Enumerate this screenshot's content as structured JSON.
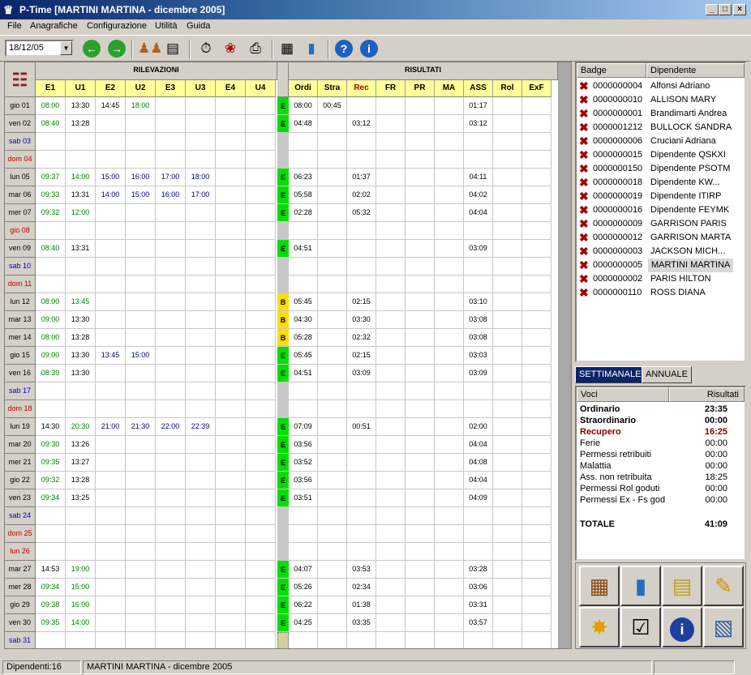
{
  "window": {
    "title": "P-Time [MARTINI MARTINA - dicembre 2005]"
  },
  "menu": [
    "File",
    "Anagrafiche",
    "Configurazione",
    "Utilità",
    "Guida"
  ],
  "toolbar": {
    "date_value": "18/12/05"
  },
  "grid": {
    "group_rilevazioni": "RILEVAZIONI",
    "group_risultati": "RISULTATI",
    "punch_cols": [
      "E1",
      "U1",
      "E2",
      "U2",
      "E3",
      "U3",
      "E4",
      "U4"
    ],
    "result_cols": [
      "Ordi",
      "Stra",
      "Rec",
      "FR",
      "PR",
      "MA",
      "ASS",
      "Rol",
      "ExF"
    ],
    "rows": [
      {
        "day": "gio 01",
        "type": "weekday",
        "p": [
          "08:00",
          "13:30",
          "14:45",
          "18:00",
          "",
          "",
          "",
          ""
        ],
        "s": "E",
        "r": [
          "08:00",
          "00:45",
          "",
          "",
          "",
          "",
          "01:17",
          "",
          ""
        ]
      },
      {
        "day": "ven 02",
        "type": "weekday",
        "p": [
          "08:40",
          "13:28",
          "",
          "",
          "",
          "",
          "",
          ""
        ],
        "s": "E",
        "r": [
          "04:48",
          "",
          "03:12",
          "",
          "",
          "",
          "03:12",
          "",
          ""
        ]
      },
      {
        "day": "sab 03",
        "type": "saturday",
        "p": [
          "",
          "",
          "",
          "",
          "",
          "",
          "",
          ""
        ],
        "s": "",
        "r": [
          "",
          "",
          "",
          "",
          "",
          "",
          "",
          "",
          ""
        ]
      },
      {
        "day": "dom 04",
        "type": "sunday",
        "p": [
          "",
          "",
          "",
          "",
          "",
          "",
          "",
          ""
        ],
        "s": "",
        "r": [
          "",
          "",
          "",
          "",
          "",
          "",
          "",
          "",
          ""
        ]
      },
      {
        "day": "lun 05",
        "type": "weekday",
        "p": [
          "09:37",
          "14:00",
          "15:00",
          "16:00",
          "17:00",
          "18:00",
          "",
          ""
        ],
        "s": "E",
        "r": [
          "06:23",
          "",
          "01:37",
          "",
          "",
          "",
          "04:11",
          "",
          ""
        ]
      },
      {
        "day": "mar 06",
        "type": "weekday",
        "p": [
          "09:33",
          "13:31",
          "14:00",
          "15:00",
          "16:00",
          "17:00",
          "",
          ""
        ],
        "s": "E",
        "r": [
          "05:58",
          "",
          "02:02",
          "",
          "",
          "",
          "04:02",
          "",
          ""
        ]
      },
      {
        "day": "mer 07",
        "type": "weekday",
        "p": [
          "09:32",
          "12:00",
          "",
          "",
          "",
          "",
          "",
          ""
        ],
        "s": "E",
        "r": [
          "02:28",
          "",
          "05:32",
          "",
          "",
          "",
          "04:04",
          "",
          ""
        ]
      },
      {
        "day": "gio 08",
        "type": "holiday",
        "p": [
          "",
          "",
          "",
          "",
          "",
          "",
          "",
          ""
        ],
        "s": "",
        "r": [
          "",
          "",
          "",
          "",
          "",
          "",
          "",
          "",
          ""
        ]
      },
      {
        "day": "ven 09",
        "type": "weekday",
        "p": [
          "08:40",
          "13:31",
          "",
          "",
          "",
          "",
          "",
          ""
        ],
        "s": "E",
        "r": [
          "04:51",
          "",
          "",
          "",
          "",
          "",
          "03:09",
          "",
          ""
        ]
      },
      {
        "day": "sab 10",
        "type": "saturday",
        "p": [
          "",
          "",
          "",
          "",
          "",
          "",
          "",
          ""
        ],
        "s": "",
        "r": [
          "",
          "",
          "",
          "",
          "",
          "",
          "",
          "",
          ""
        ]
      },
      {
        "day": "dom 11",
        "type": "sunday",
        "p": [
          "",
          "",
          "",
          "",
          "",
          "",
          "",
          ""
        ],
        "s": "",
        "r": [
          "",
          "",
          "",
          "",
          "",
          "",
          "",
          "",
          ""
        ]
      },
      {
        "day": "lun 12",
        "type": "weekday",
        "p": [
          "08:00",
          "13:45",
          "",
          "",
          "",
          "",
          "",
          ""
        ],
        "s": "B",
        "r": [
          "05:45",
          "",
          "02:15",
          "",
          "",
          "",
          "03:10",
          "",
          ""
        ]
      },
      {
        "day": "mar 13",
        "type": "weekday",
        "p": [
          "09:00",
          "13:30",
          "",
          "",
          "",
          "",
          "",
          ""
        ],
        "s": "B",
        "r": [
          "04:30",
          "",
          "03:30",
          "",
          "",
          "",
          "03:08",
          "",
          ""
        ]
      },
      {
        "day": "mer 14",
        "type": "weekday",
        "p": [
          "08:00",
          "13:28",
          "",
          "",
          "",
          "",
          "",
          ""
        ],
        "s": "B",
        "r": [
          "05:28",
          "",
          "02:32",
          "",
          "",
          "",
          "03:08",
          "",
          ""
        ]
      },
      {
        "day": "gio 15",
        "type": "weekday",
        "p": [
          "09:00",
          "13:30",
          "13:45",
          "15:00",
          "",
          "",
          "",
          ""
        ],
        "s": "E",
        "r": [
          "05:45",
          "",
          "02:15",
          "",
          "",
          "",
          "03:03",
          "",
          ""
        ]
      },
      {
        "day": "ven 16",
        "type": "weekday",
        "p": [
          "08:39",
          "13:30",
          "",
          "",
          "",
          "",
          "",
          ""
        ],
        "s": "E",
        "r": [
          "04:51",
          "",
          "03:09",
          "",
          "",
          "",
          "03:09",
          "",
          ""
        ]
      },
      {
        "day": "sab 17",
        "type": "saturday",
        "p": [
          "",
          "",
          "",
          "",
          "",
          "",
          "",
          ""
        ],
        "s": "",
        "r": [
          "",
          "",
          "",
          "",
          "",
          "",
          "",
          "",
          ""
        ]
      },
      {
        "day": "dom 18",
        "type": "sunday",
        "p": [
          "",
          "",
          "",
          "",
          "",
          "",
          "",
          ""
        ],
        "s": "",
        "r": [
          "",
          "",
          "",
          "",
          "",
          "",
          "",
          "",
          ""
        ]
      },
      {
        "day": "lun 19",
        "type": "weekday",
        "p": [
          "14:30",
          "20:30",
          "21:00",
          "21:30",
          "22:00",
          "22:39",
          "",
          ""
        ],
        "s": "E",
        "r": [
          "07:09",
          "",
          "00:51",
          "",
          "",
          "",
          "02:00",
          "",
          ""
        ]
      },
      {
        "day": "mar 20",
        "type": "weekday",
        "p": [
          "09:30",
          "13:26",
          "",
          "",
          "",
          "",
          "",
          ""
        ],
        "s": "E",
        "r": [
          "03:56",
          "",
          "",
          "",
          "",
          "",
          "04:04",
          "",
          ""
        ]
      },
      {
        "day": "mer 21",
        "type": "weekday",
        "p": [
          "09:35",
          "13:27",
          "",
          "",
          "",
          "",
          "",
          ""
        ],
        "s": "E",
        "r": [
          "03:52",
          "",
          "",
          "",
          "",
          "",
          "04:08",
          "",
          ""
        ]
      },
      {
        "day": "gio 22",
        "type": "weekday",
        "p": [
          "09:32",
          "13:28",
          "",
          "",
          "",
          "",
          "",
          ""
        ],
        "s": "E",
        "r": [
          "03:56",
          "",
          "",
          "",
          "",
          "",
          "04:04",
          "",
          ""
        ]
      },
      {
        "day": "ven 23",
        "type": "weekday",
        "p": [
          "09:34",
          "13:25",
          "",
          "",
          "",
          "",
          "",
          ""
        ],
        "s": "E",
        "r": [
          "03:51",
          "",
          "",
          "",
          "",
          "",
          "04:09",
          "",
          ""
        ]
      },
      {
        "day": "sab 24",
        "type": "saturday",
        "p": [
          "",
          "",
          "",
          "",
          "",
          "",
          "",
          ""
        ],
        "s": "",
        "r": [
          "",
          "",
          "",
          "",
          "",
          "",
          "",
          "",
          ""
        ]
      },
      {
        "day": "dom 25",
        "type": "sunday",
        "p": [
          "",
          "",
          "",
          "",
          "",
          "",
          "",
          ""
        ],
        "s": "",
        "r": [
          "",
          "",
          "",
          "",
          "",
          "",
          "",
          "",
          ""
        ]
      },
      {
        "day": "lun 26",
        "type": "holiday",
        "p": [
          "",
          "",
          "",
          "",
          "",
          "",
          "",
          ""
        ],
        "s": "",
        "r": [
          "",
          "",
          "",
          "",
          "",
          "",
          "",
          "",
          ""
        ]
      },
      {
        "day": "mar 27",
        "type": "weekday",
        "p": [
          "14:53",
          "19:00",
          "",
          "",
          "",
          "",
          "",
          ""
        ],
        "s": "E",
        "r": [
          "04:07",
          "",
          "03:53",
          "",
          "",
          "",
          "03:28",
          "",
          ""
        ]
      },
      {
        "day": "mer 28",
        "type": "weekday",
        "p": [
          "09:34",
          "15:00",
          "",
          "",
          "",
          "",
          "",
          ""
        ],
        "s": "E",
        "r": [
          "05:26",
          "",
          "02:34",
          "",
          "",
          "",
          "03:06",
          "",
          ""
        ]
      },
      {
        "day": "gio 29",
        "type": "weekday",
        "p": [
          "09:38",
          "16:00",
          "",
          "",
          "",
          "",
          "",
          ""
        ],
        "s": "E",
        "r": [
          "06:22",
          "",
          "01:38",
          "",
          "",
          "",
          "03:31",
          "",
          ""
        ]
      },
      {
        "day": "ven 30",
        "type": "weekday",
        "p": [
          "09:35",
          "14:00",
          "",
          "",
          "",
          "",
          "",
          ""
        ],
        "s": "E",
        "r": [
          "04:25",
          "",
          "03:35",
          "",
          "",
          "",
          "03:57",
          "",
          ""
        ]
      },
      {
        "day": "sab 31",
        "type": "saturday",
        "p": [
          "",
          "",
          "",
          "",
          "",
          "",
          "",
          ""
        ],
        "s": "sel",
        "r": [
          "",
          "",
          "",
          "",
          "",
          "",
          "",
          "",
          ""
        ]
      }
    ]
  },
  "employees": {
    "col_badge": "Badge",
    "col_name": "Dipendente",
    "items": [
      {
        "badge": "0000000004",
        "name": "Alfonsi Adriano"
      },
      {
        "badge": "0000000010",
        "name": "ALLISON MARY"
      },
      {
        "badge": "0000000001",
        "name": "Brandimarti Andrea"
      },
      {
        "badge": "0000001212",
        "name": "BULLOCK SANDRA"
      },
      {
        "badge": "0000000006",
        "name": "Cruciani Adriana"
      },
      {
        "badge": "0000000015",
        "name": "Dipendente QSKXI"
      },
      {
        "badge": "0000000150",
        "name": "Dipendente PSOTM"
      },
      {
        "badge": "0000000018",
        "name": "Dipendente KW..."
      },
      {
        "badge": "0000000019",
        "name": "Dipendente ITIRP"
      },
      {
        "badge": "0000000016",
        "name": "Dipendente FEYMK"
      },
      {
        "badge": "0000000009",
        "name": "GARRISON PARIS"
      },
      {
        "badge": "0000000012",
        "name": "GARRISON MARTA"
      },
      {
        "badge": "0000000003",
        "name": "JACKSON MICH..."
      },
      {
        "badge": "0000000005",
        "name": "MARTINI MARTINA",
        "selected": true
      },
      {
        "badge": "0000000002",
        "name": "PARIS HILTON"
      },
      {
        "badge": "0000000110",
        "name": "ROSS DIANA"
      }
    ]
  },
  "summary": {
    "tab_weekly": "SETTIMANALE",
    "tab_annual": "ANNUALE",
    "col_voci": "Voci",
    "col_risultati": "Risultati",
    "items": [
      {
        "label": "Ordinario",
        "value": "23:35",
        "style": "bold"
      },
      {
        "label": "Straordinario",
        "value": "00:00",
        "style": "bold"
      },
      {
        "label": "Recupero",
        "value": "16:25",
        "style": "red"
      },
      {
        "label": "Ferie",
        "value": "00:00",
        "style": ""
      },
      {
        "label": "Permessi retribuiti",
        "value": "00:00",
        "style": ""
      },
      {
        "label": "Malattia",
        "value": "00:00",
        "style": ""
      },
      {
        "label": "Ass. non retribuita",
        "value": "18:25",
        "style": ""
      },
      {
        "label": "Permessi Rol goduti",
        "value": "00:00",
        "style": ""
      },
      {
        "label": "Permessi Ex - Fs god",
        "value": "00:00",
        "style": ""
      }
    ],
    "total_label": "TOTALE",
    "total_value": "41:09"
  },
  "status": {
    "count": "Dipendenti:16",
    "current": "MARTINI MARTINA - dicembre 2005"
  },
  "colors": {
    "green_status": "#00e000",
    "yellow_status": "#ffdd00",
    "header_yellow": "#ffff99",
    "punch_green": "#008000",
    "punch_blue": "#000080",
    "weekend_blue": "#0000c0",
    "holiday_red": "#c00000",
    "title_blue": "#0a246a"
  }
}
